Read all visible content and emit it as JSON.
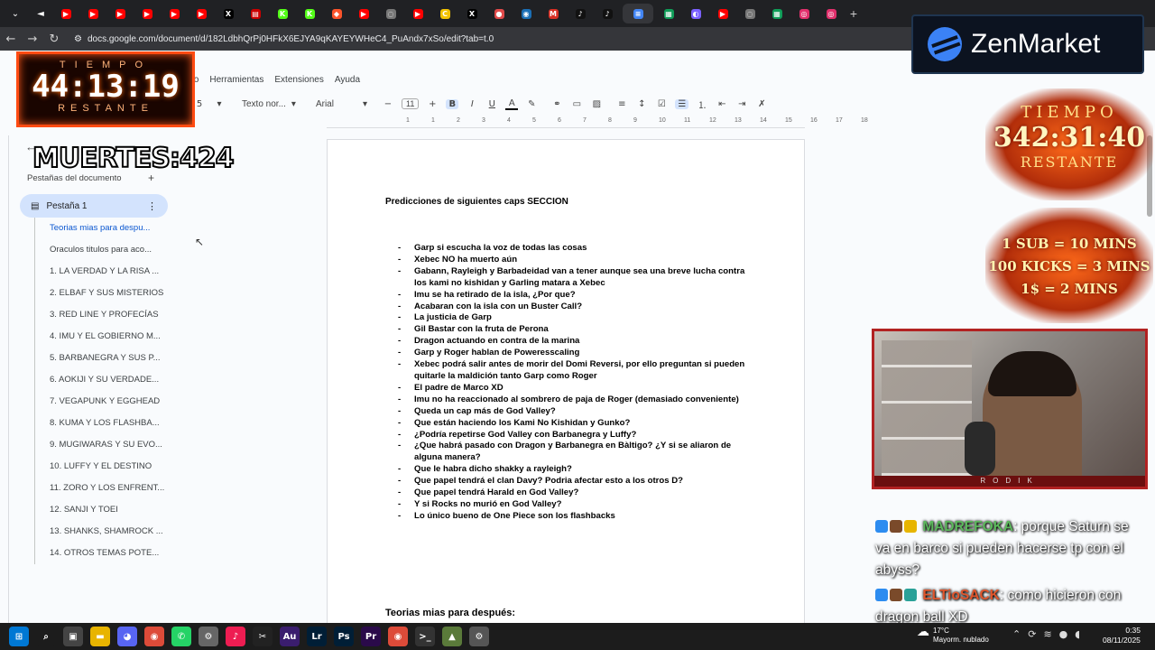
{
  "browser": {
    "url": "docs.google.com/document/d/182LdbhQrPj0HFkX6EJYA9qKAYEYWHeC4_PuAndx7xSo/edit?tab=t.0",
    "tabs": [
      {
        "icon": "youtube-icon",
        "color": "#ff0000",
        "glyph": "▶"
      },
      {
        "icon": "youtube-icon",
        "color": "#ff0000",
        "glyph": "▶"
      },
      {
        "icon": "youtube-icon",
        "color": "#ff0000",
        "glyph": "▶"
      },
      {
        "icon": "youtube-icon",
        "color": "#ff0000",
        "glyph": "▶"
      },
      {
        "icon": "youtube-icon",
        "color": "#ff0000",
        "glyph": "▶"
      },
      {
        "icon": "youtube-icon",
        "color": "#ff0000",
        "glyph": "▶"
      },
      {
        "icon": "x-icon",
        "color": "#000000",
        "glyph": "X"
      },
      {
        "icon": "news-icon",
        "color": "#cc0000",
        "glyph": "▤"
      },
      {
        "icon": "kick-icon",
        "color": "#53fc18",
        "glyph": "K"
      },
      {
        "icon": "kick-icon",
        "color": "#53fc18",
        "glyph": "K"
      },
      {
        "icon": "brave-icon",
        "color": "#fb542b",
        "glyph": "◆"
      },
      {
        "icon": "youtube-icon",
        "color": "#ff0000",
        "glyph": "▶"
      },
      {
        "icon": "globe-icon",
        "color": "#777777",
        "glyph": "◌"
      },
      {
        "icon": "youtube-icon",
        "color": "#ff0000",
        "glyph": "▶"
      },
      {
        "icon": "c-icon",
        "color": "#f2c200",
        "glyph": "C"
      },
      {
        "icon": "x-icon",
        "color": "#000000",
        "glyph": "X"
      },
      {
        "icon": "mascot-icon",
        "color": "#e04a4a",
        "glyph": "●"
      },
      {
        "icon": "steam-icon",
        "color": "#1b6fb5",
        "glyph": "◉"
      },
      {
        "icon": "gmail-icon",
        "color": "#d93025",
        "glyph": "M"
      },
      {
        "icon": "tiktok-icon",
        "color": "#111111",
        "glyph": "♪"
      },
      {
        "icon": "tiktok-icon",
        "color": "#111111",
        "glyph": "♪"
      },
      {
        "icon": "docs-icon",
        "color": "#4285f4",
        "glyph": "≡"
      },
      {
        "icon": "sheets-icon",
        "color": "#0f9d58",
        "glyph": "▦"
      },
      {
        "icon": "ext-icon",
        "color": "#7b61ff",
        "glyph": "◐"
      },
      {
        "icon": "youtube-icon",
        "color": "#ff0000",
        "glyph": "▶"
      },
      {
        "icon": "globe-icon",
        "color": "#777777",
        "glyph": "◌"
      },
      {
        "icon": "sheets-icon",
        "color": "#0f9d58",
        "glyph": "▦"
      },
      {
        "icon": "instagram-icon",
        "color": "#e1306c",
        "glyph": "◎"
      },
      {
        "icon": "instagram-icon",
        "color": "#e1306c",
        "glyph": "◎"
      }
    ]
  },
  "docs": {
    "menu": [
      "to",
      "Herramientas",
      "Extensiones",
      "Ayuda"
    ],
    "toolbar": {
      "style": "Texto nor...",
      "font": "Arial",
      "size": "11",
      "left_fragment": "5"
    },
    "ruler": [
      "1",
      "1",
      "2",
      "3",
      "4",
      "5",
      "6",
      "7",
      "8",
      "9",
      "10",
      "11",
      "12",
      "13",
      "14",
      "15",
      "16",
      "17",
      "18"
    ],
    "sidebar": {
      "title": "Pestañas del documento",
      "tab_label": "Pestaña 1",
      "outline": [
        "Teorias mias para despu...",
        "Oraculos titulos para aco...",
        "1. LA VERDAD Y LA RISA ...",
        "2. ELBAF Y SUS MISTERIOS",
        "3. RED LINE Y PROFECÍAS",
        "4. IMU Y EL GOBIERNO M...",
        "5. BARBANEGRA Y SUS P...",
        "6. AOKIJI Y SU VERDADE...",
        "7. VEGAPUNK Y EGGHEAD",
        "8. KUMA Y LOS FLASHBA...",
        "9. MUGIWARAS Y SU EVO...",
        "10. LUFFY Y EL DESTINO",
        "11. ZORO Y LOS ENFRENT...",
        "12. SANJI Y TOEI",
        "13. SHANKS, SHAMROCK ...",
        "14. OTROS TEMAS POTE..."
      ]
    },
    "page": {
      "heading": "Predicciones de siguientes caps SECCION",
      "bullets": [
        "Garp si escucha la voz de todas las cosas",
        "Xebec NO ha muerto aún",
        "Gabann, Rayleigh y Barbadeidad van a tener aunque sea una breve lucha contra los kami no kishidan y Garling matara a Xebec",
        "Imu se ha retirado de la isla, ¿Por que?",
        "Acabaran con la isla con un Buster Call?",
        "La justicia de Garp",
        "Gil Bastar con la fruta de Perona",
        "Dragon actuando en contra de la marina",
        "Garp y Roger hablan de Poweresscaling",
        "Xebec podrá salir antes de morir del Domi Reversi, por ello preguntan si pueden quitarle la maldición tanto Garp como Roger",
        "El padre de Marco XD",
        "Imu no ha reaccionado al sombrero de paja de Roger (demasiado conveniente)",
        "Queda un cap más de God Valley?",
        "Que están haciendo los Kami No Kishidan y Gunko?",
        "¿Podría repetirse God Valley con Barbanegra y Luffy?",
        "¿Que habrá pasado con Dragon y Barbanegra en Bàltigo? ¿Y si se aliaron de alguna manera?",
        "Que le habra dicho shakky a rayleigh?",
        "Que papel tendrá el clan Davy? Podria afectar esto a los otros D?",
        "Que papel tendrá Harald en God Valley?",
        "Y si Rocks no murió en God Valley?",
        "Lo único bueno de One Piece son los flashbacks"
      ],
      "section2": "Teorias mias para después:"
    }
  },
  "overlays": {
    "timer_top": {
      "label": "TIEMPO",
      "value": "44:13:19",
      "label2": "RESTANTE"
    },
    "deaths": "MUERTES:424",
    "sponsor": "ZenMarket",
    "timer_fire": {
      "label": "TIEMPO",
      "value": "342:31:40",
      "label2": "RESTANTE"
    },
    "rates": [
      "1 SUB = 10 MINS",
      "100 KICKS = 3 MINS",
      "1$ = 2 MINS"
    ],
    "cam_tag": "RODIK",
    "chat": [
      {
        "user": "MADREFOKA",
        "text": ": porque Saturn se va en barco si pueden hacerse tp con el abyss?"
      },
      {
        "user": "ELTioSACK",
        "text": ": como hicieron con dragon ball XD"
      }
    ]
  },
  "taskbar": {
    "apps": [
      {
        "name": "windows",
        "color": "#0078d4",
        "glyph": "⊞"
      },
      {
        "name": "search",
        "color": "#1c1c1c",
        "glyph": "⌕"
      },
      {
        "name": "taskview",
        "color": "#444444",
        "glyph": "▣"
      },
      {
        "name": "files",
        "color": "#e8b400",
        "glyph": "▬"
      },
      {
        "name": "discord",
        "color": "#5865f2",
        "glyph": "◕"
      },
      {
        "name": "chrome",
        "color": "#dd4b39",
        "glyph": "◉"
      },
      {
        "name": "whatsapp",
        "color": "#25d366",
        "glyph": "✆"
      },
      {
        "name": "app",
        "color": "#666666",
        "glyph": "⚙"
      },
      {
        "name": "tiktok",
        "color": "#ee1d52",
        "glyph": "♪"
      },
      {
        "name": "capcut",
        "color": "#222222",
        "glyph": "✂"
      },
      {
        "name": "audition",
        "color": "#3a1d6e",
        "glyph": "Au"
      },
      {
        "name": "lightroom",
        "color": "#001e36",
        "glyph": "Lr"
      },
      {
        "name": "photoshop",
        "color": "#001e36",
        "glyph": "Ps"
      },
      {
        "name": "premiere",
        "color": "#2a0a4a",
        "glyph": "Pr"
      },
      {
        "name": "chrome-active",
        "color": "#dd4b39",
        "glyph": "◉"
      },
      {
        "name": "terminal",
        "color": "#333333",
        "glyph": ">_"
      },
      {
        "name": "game",
        "color": "#5a7a3a",
        "glyph": "▲"
      },
      {
        "name": "settings",
        "color": "#555555",
        "glyph": "⚙"
      }
    ],
    "weather_temp": "17°C",
    "weather_text": "Mayorm. nublado",
    "time": "0:35",
    "date": "08/11/2025"
  }
}
